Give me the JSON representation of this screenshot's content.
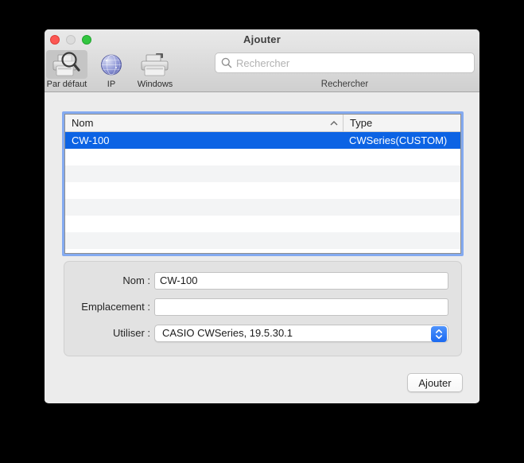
{
  "window": {
    "title": "Ajouter"
  },
  "toolbar": {
    "items": [
      {
        "label": "Par défaut",
        "selected": true,
        "icon": "printer-search-icon"
      },
      {
        "label": "IP",
        "selected": false,
        "icon": "globe-icon"
      },
      {
        "label": "Windows",
        "selected": false,
        "icon": "printer-icon"
      }
    ],
    "search": {
      "placeholder": "Rechercher",
      "label": "Rechercher"
    }
  },
  "table": {
    "columns": [
      {
        "label": "Nom",
        "sort": "asc"
      },
      {
        "label": "Type"
      }
    ],
    "rows": [
      {
        "nom": "CW-100",
        "type": "CWSeries(CUSTOM)",
        "selected": true
      }
    ]
  },
  "form": {
    "fields": [
      {
        "label": "Nom :",
        "value": "CW-100",
        "type": "text"
      },
      {
        "label": "Emplacement :",
        "value": "",
        "type": "text"
      },
      {
        "label": "Utiliser :",
        "value": "CASIO CWSeries, 19.5.30.1",
        "type": "select"
      }
    ]
  },
  "actions": {
    "add_label": "Ajouter"
  },
  "colors": {
    "selection_blue": "#0c63e4",
    "focus_ring": "#84aaf0",
    "popup_accent": "#1a69f1",
    "window_bg": "#ececec"
  }
}
